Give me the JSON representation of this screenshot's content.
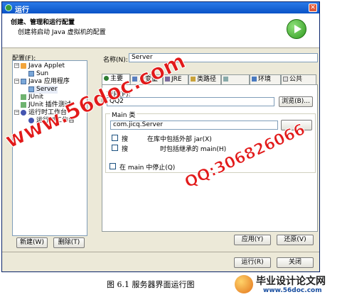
{
  "window": {
    "title": "运行",
    "close_glyph": "✕"
  },
  "header": {
    "title": "创建、管理和运行配置",
    "subtitle": "创建将启动 Java 虚拟机的配置",
    "icon": "run-icon"
  },
  "sidebar": {
    "label": "配置(F):",
    "tree": [
      {
        "label": "Java Applet",
        "icon": "java-applet-icon",
        "expander": "−"
      },
      {
        "label": "Sun",
        "icon": "applet-config-icon",
        "expander": ""
      },
      {
        "label": "Java 应用程序",
        "icon": "java-app-icon",
        "expander": "−"
      },
      {
        "label": "Server",
        "icon": "app-config-icon",
        "expander": ""
      },
      {
        "label": "JUnit",
        "icon": "junit-icon",
        "expander": ""
      },
      {
        "label": "JUnit 插件测试",
        "icon": "junit-plugin-icon",
        "expander": ""
      },
      {
        "label": "运行时工作台",
        "icon": "runtime-workbench-icon",
        "expander": "−"
      },
      {
        "label": "运行时工作台",
        "icon": "runtime-workbench-config-icon",
        "expander": ""
      }
    ],
    "new_button": "新建(W)",
    "delete_button": "删除(T)"
  },
  "main": {
    "name_label": "名称(N):",
    "name_value": "Server",
    "tabs": [
      {
        "label": "主要",
        "active": true
      },
      {
        "label": "自变量",
        "active": false
      },
      {
        "label": "JRE",
        "active": false
      },
      {
        "label": "类路径",
        "active": false
      },
      {
        "label": "",
        "active": false
      },
      {
        "label": "环境",
        "active": false
      },
      {
        "label": "公共",
        "active": false
      }
    ],
    "project_label": "项目(P):",
    "project_value": "QQ2",
    "browse_button": "浏览(B)...",
    "main_class_group": "Main 类",
    "main_class_value": "com.jicq.Server",
    "search_button": "",
    "checkbox_external_jar": "在库中包括外部 jar(X)",
    "checkbox_external_jar_prefix": "搜",
    "checkbox_inherited_main": "时包括继承的 main(H)",
    "checkbox_inherited_main_prefix": "搜",
    "stop_in_main": "在 main 中停止(Q)",
    "apply_button": "应用(Y)",
    "revert_button": "还原(V)"
  },
  "footer": {
    "run_button": "运行(R)",
    "close_button": "关闭"
  },
  "watermarks": {
    "site": "www.56doc.com",
    "qq": "QQ:306826066"
  },
  "caption": "图 6.1 服务器界面运行图",
  "logo": {
    "title": "毕业设计论文网",
    "url": "www.56doc.com"
  },
  "colors": {
    "titlebar": "#0a53c7",
    "watermark": "#e21a1a",
    "dialog_bg": "#ece9d8"
  }
}
